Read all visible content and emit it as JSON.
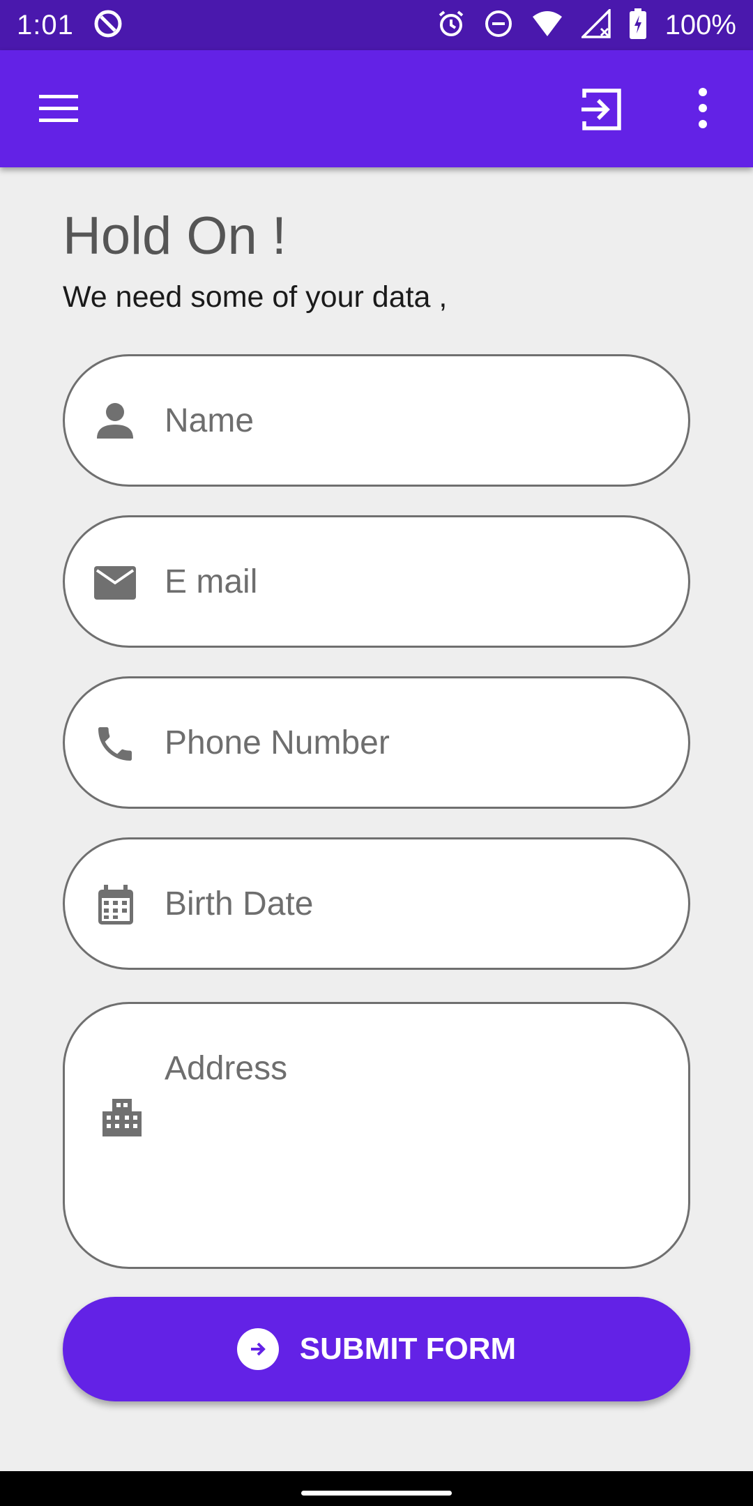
{
  "status_bar": {
    "time": "1:01",
    "battery": "100%",
    "icons": [
      "sync-icon",
      "alarm-icon",
      "dnd-icon",
      "wifi-icon",
      "signal-icon",
      "battery-icon"
    ]
  },
  "app_bar": {
    "color": "#6322e6",
    "icons": [
      "menu-icon",
      "exit-icon",
      "more-vert-icon"
    ]
  },
  "header": {
    "title": "Hold On !",
    "subtitle": "We need some of your data ,"
  },
  "form": {
    "name": {
      "placeholder": "Name",
      "icon": "person-icon"
    },
    "email": {
      "placeholder": "E mail",
      "icon": "email-icon"
    },
    "phone": {
      "placeholder": "Phone Number",
      "icon": "phone-icon"
    },
    "birth_date": {
      "placeholder": "Birth Date",
      "icon": "calendar-icon"
    },
    "address": {
      "placeholder": "Address",
      "icon": "building-icon"
    }
  },
  "submit": {
    "label": "SUBMIT FORM",
    "icon": "arrow-circle-icon",
    "color": "#6322e6"
  }
}
